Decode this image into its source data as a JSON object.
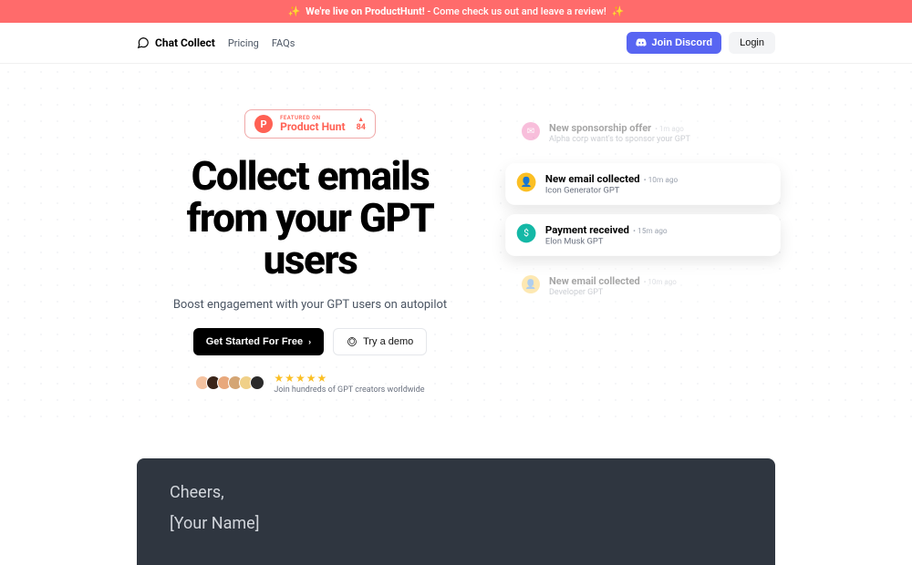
{
  "banner": {
    "prefix": "✨",
    "bold": "We're live on ProductHunt!",
    "rest": " - Come check us out and leave a review! ",
    "suffix": "✨"
  },
  "nav": {
    "brand": "Chat Collect",
    "links": [
      "Pricing",
      "FAQs"
    ],
    "discord": "Join Discord",
    "login": "Login"
  },
  "ph": {
    "featured": "Featured on",
    "name": "Product Hunt",
    "votes": "84"
  },
  "hero": {
    "headline_l1": "Collect emails",
    "headline_l2": "from your GPT",
    "headline_l3": "users",
    "sub": "Boost engagement with your GPT users on autopilot",
    "cta_primary": "Get Started For Free",
    "cta_secondary": "Try a demo",
    "social_text": "Join hundreds of GPT creators worldwide"
  },
  "notifs": [
    {
      "title": "New sponsorship offer",
      "time": "• 1m ago",
      "sub": "Alpha corp want's to sponsor your GPT",
      "icon": "pink",
      "glyph": "✉",
      "variant": "dim"
    },
    {
      "title": "New email collected",
      "time": "• 10m ago",
      "sub": "Icon Generator GPT",
      "icon": "yellow",
      "glyph": "👤",
      "variant": "lg"
    },
    {
      "title": "Payment received",
      "time": "• 15m ago",
      "sub": "Elon Musk GPT",
      "icon": "teal",
      "glyph": "$",
      "variant": "lg"
    },
    {
      "title": "New email collected",
      "time": "• 10m ago",
      "sub": "Developer GPT",
      "icon": "yellow",
      "glyph": "👤",
      "variant": "dim"
    }
  ],
  "email": {
    "l1": "Cheers,",
    "l2": "[Your Name]"
  }
}
